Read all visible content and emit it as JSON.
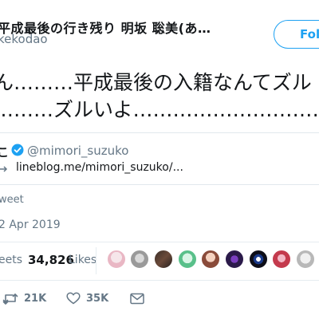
{
  "header": {
    "display_name": "平成最後の行き残り 明坂 聡美(あ…",
    "handle": "kekodao",
    "follow_label": "Follo"
  },
  "tweet": {
    "line1": "ん………平成最後の入籍なんてズル",
    "line2": "………ズルいよ……………………………"
  },
  "quote": {
    "name_fragment": "こ",
    "handle": "@mimori_suzuko",
    "link": "lineblog.me/mimori_suzuko/..."
  },
  "meta": {
    "source": "weet",
    "date": "2 Apr 2019"
  },
  "stats": {
    "retweets_label": "eets",
    "likes_count": "34,826",
    "likes_label": "Likes"
  },
  "actions": {
    "retweet_count": "21K",
    "like_count": "35K"
  },
  "colors": {
    "accent": "#1da1f2",
    "text": "#14171a",
    "muted": "#657786",
    "border": "#e6ecf0"
  }
}
